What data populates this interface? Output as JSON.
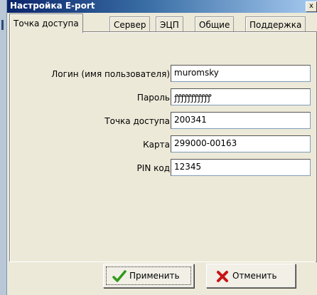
{
  "window": {
    "title": "Настройка E-port",
    "close_glyph": "x"
  },
  "tabs": [
    {
      "label": "Точка доступа",
      "active": true
    },
    {
      "label": "Сервер",
      "active": false
    },
    {
      "label": "ЭЦП",
      "active": false
    },
    {
      "label": "Общие",
      "active": false
    },
    {
      "label": "Поддержка",
      "active": false
    }
  ],
  "form": {
    "login_label": "Логин (имя пользователя)",
    "login_value": "muromsky",
    "password_label": "Пароль",
    "password_value": "ꝭꝭꝭꝭꝭꝭꝭꝭꝭꝭꝭ",
    "access_point_label": "Точка доступа",
    "access_point_value": "200341",
    "card_label": "Карта",
    "card_value": "299000-00163",
    "pin_label": "PIN код",
    "pin_value": "12345"
  },
  "buttons": {
    "apply_label": "Применить",
    "apply_icon": "checkmark-icon",
    "cancel_label": "Отменить",
    "cancel_icon": "x-icon"
  },
  "colors": {
    "title_start": "#0a246a",
    "check": "#2f9a1a",
    "cross": "#c81414"
  }
}
